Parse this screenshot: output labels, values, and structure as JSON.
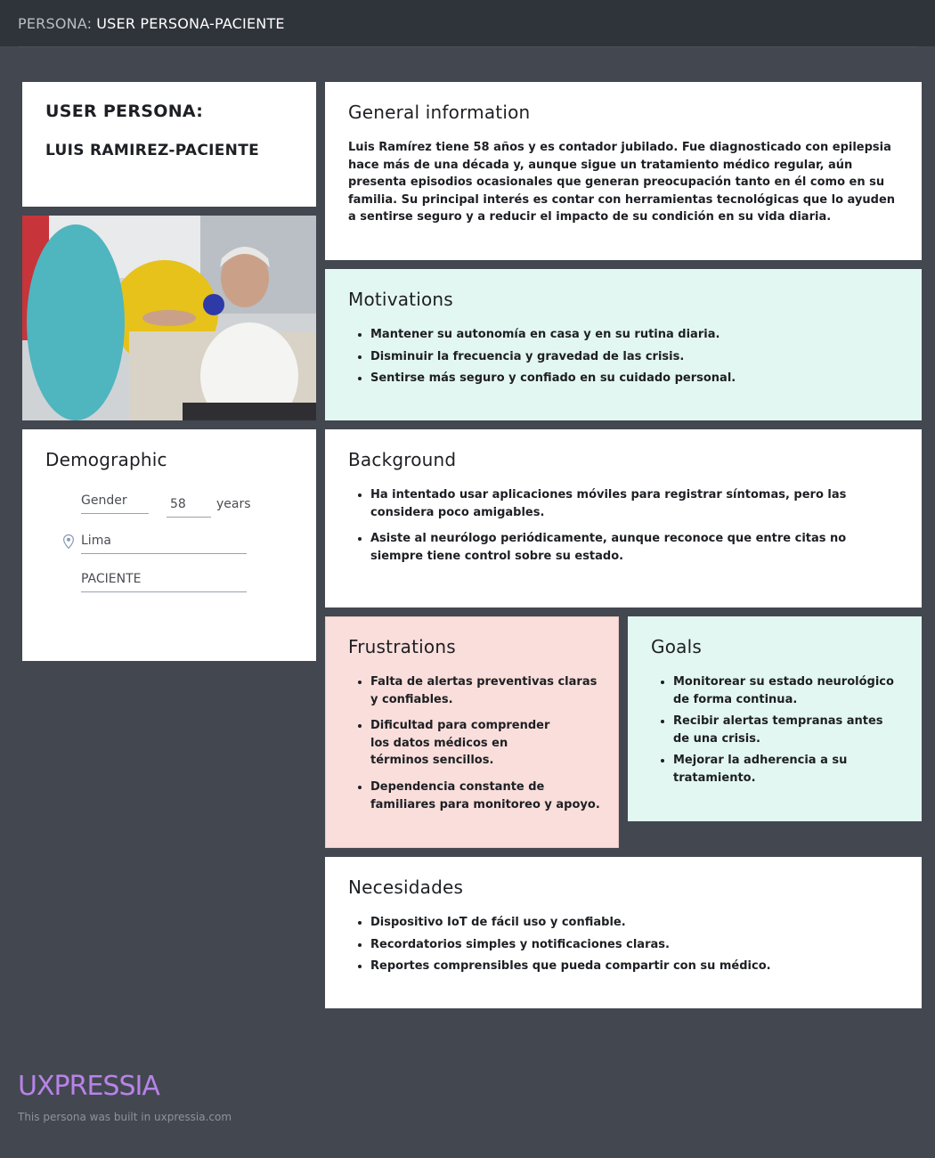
{
  "header": {
    "prefix": "PERSONA:",
    "title": "USER PERSONA-PACIENTE"
  },
  "persona": {
    "label": "USER PERSONA:",
    "name": "LUIS RAMIREZ-PACIENTE"
  },
  "photo": {
    "alt": "photo"
  },
  "demographic": {
    "title": "Demographic",
    "gender": "Gender",
    "age": "58",
    "age_unit": "years",
    "location": "Lima",
    "occupation": "PACIENTE"
  },
  "general_information": {
    "title": "General information",
    "text": "Luis Ramírez tiene 58 años y es contador jubilado. Fue diagnosticado con epilepsia hace más de una década y, aunque sigue un tratamiento médico regular, aún presenta episodios ocasionales que generan preocupación tanto en él como en su familia. Su principal interés es contar con herramientas tecnológicas que lo ayuden a sentirse seguro y a reducir el impacto de su condición en su vida diaria."
  },
  "motivations": {
    "title": "Motivations",
    "items": [
      "Mantener su autonomía en casa y en su rutina diaria.",
      "Disminuir la frecuencia y gravedad de las crisis.",
      "Sentirse más seguro y confiado en su cuidado personal."
    ]
  },
  "background": {
    "title": "Background",
    "items": [
      "Ha intentado usar aplicaciones móviles para registrar síntomas, pero las considera poco amigables.",
      "Asiste al neurólogo periódicamente, aunque reconoce que entre citas no siempre tiene control sobre su estado."
    ]
  },
  "frustrations": {
    "title": "Frustrations",
    "items": [
      "Falta de alertas preventivas claras y confiables.",
      "Dificultad para comprender los datos médicos en términos sencillos.",
      "Dependencia constante de familiares para monitoreo y apoyo."
    ]
  },
  "goals": {
    "title": "Goals",
    "items": [
      "Monitorear su estado neurológico de forma continua.",
      "Recibir alertas tempranas antes de una crisis.",
      "Mejorar la adherencia a su tratamiento."
    ]
  },
  "needs": {
    "title": "Necesidades",
    "items": [
      "Dispositivo IoT de fácil uso y confiable.",
      "Recordatorios simples y notificaciones claras.",
      "Reportes comprensibles que pueda compartir con su médico."
    ]
  },
  "footer": {
    "logo": "UXPRESSIA",
    "note": "This persona was built in uxpressia.com"
  },
  "colors": {
    "background": "#434750",
    "topbar": "#2f333a",
    "mint": "#e3f7f2",
    "pink": "#f9dedb",
    "brand": "#b783e8"
  },
  "icons": {
    "location": "map-pin-icon"
  }
}
